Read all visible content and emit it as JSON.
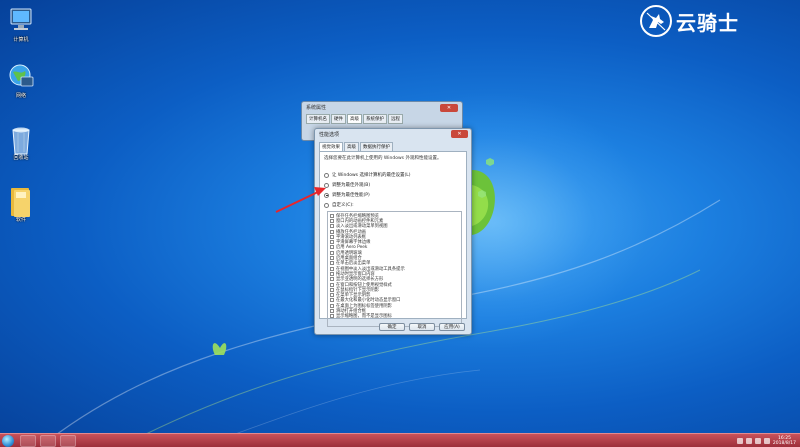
{
  "desktop": {
    "icons": [
      {
        "label": "计算机",
        "icon": "computer-icon"
      },
      {
        "label": "网络",
        "icon": "network-icon"
      },
      {
        "label": "回收站",
        "icon": "recycle-bin-icon"
      },
      {
        "label": "软件",
        "icon": "folder-icon"
      }
    ],
    "logo_text": "云骑士"
  },
  "system_properties": {
    "title": "系统属性",
    "close_label": "✕",
    "tabs": [
      "计算机名",
      "硬件",
      "高级",
      "系统保护",
      "远程"
    ]
  },
  "performance_options": {
    "title": "性能选项",
    "close_label": "✕",
    "tabs": [
      "视觉效果",
      "高级",
      "数据执行保护"
    ],
    "description": "选择您要在此计算机上使用的 Windows 外观和性能设置。",
    "radios": [
      {
        "label": "让 Windows 选择计算机的最佳设置(L)",
        "selected": false
      },
      {
        "label": "调整为最佳外观(B)",
        "selected": false
      },
      {
        "label": "调整为最佳性能(P)",
        "selected": true
      },
      {
        "label": "自定义(C):",
        "selected": false
      }
    ],
    "checkboxes": [
      "保存任务栏缩略图预览",
      "窗口内的动画控件和元素",
      "淡入淡出或滑动菜单到视图",
      "播放任务栏动画",
      "平滑滚动列表框",
      "平滑屏幕字体边缘",
      "启用 Aero Peek",
      "启用透明玻璃",
      "启用桌面组合",
      "在单击后淡出菜单",
      "在视图中淡入淡出或滑动工具条提示",
      "拖动时显示窗口内容",
      "显示亚透明的选择长方形",
      "在窗口和按钮上使用视觉样式",
      "在鼠标指针下显示阴影",
      "在菜单下显示阴影",
      "在最大化和最小化时动态显示窗口",
      "在桌面上为图标标签使用阴影",
      "滑动打开组合框",
      "显示缩略图，而不是显示图标"
    ],
    "buttons": {
      "ok": "确定",
      "cancel": "取消",
      "apply": "应用(A)"
    }
  },
  "taskbar": {
    "clock_time": "16:25",
    "clock_date": "2018/8/17"
  },
  "colors": {
    "taskbar": "#b23e49",
    "close_button": "#c9483b",
    "arrow": "#e8262b"
  }
}
